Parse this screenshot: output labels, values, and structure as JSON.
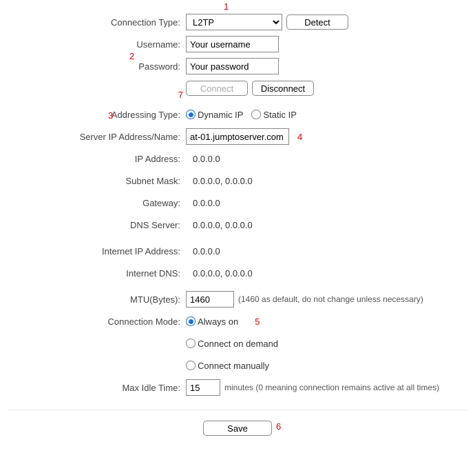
{
  "annotations": {
    "a1": "1",
    "a2": "2",
    "a3": "3",
    "a4": "4",
    "a5": "5",
    "a6": "6",
    "a7": "7"
  },
  "labels": {
    "connection_type": "Connection Type:",
    "username": "Username:",
    "password": "Password:",
    "addressing_type": "Addressing Type:",
    "server_ip": "Server IP Address/Name:",
    "ip_address": "IP Address:",
    "subnet_mask": "Subnet Mask:",
    "gateway": "Gateway:",
    "dns_server": "DNS Server:",
    "internet_ip": "Internet IP Address:",
    "internet_dns": "Internet DNS:",
    "mtu": "MTU(Bytes):",
    "connection_mode": "Connection Mode:",
    "max_idle": "Max Idle Time:"
  },
  "values": {
    "connection_type": "L2TP",
    "username": "Your username",
    "password": "Your password",
    "server_ip": "at-01.jumptoserver.com",
    "ip_address": "0.0.0.0",
    "subnet_mask": "0.0.0.0,   0.0.0.0",
    "gateway": "0.0.0.0",
    "dns_server": "0.0.0.0,   0.0.0.0",
    "internet_ip": "0.0.0.0",
    "internet_dns": "0.0.0.0,   0.0.0.0",
    "mtu": "1460",
    "max_idle": "15"
  },
  "radios": {
    "dynamic_ip": "Dynamic IP",
    "static_ip": "Static IP",
    "always_on": "Always on",
    "on_demand": "Connect on demand",
    "manually": "Connect manually"
  },
  "buttons": {
    "detect": "Detect",
    "connect": "Connect",
    "disconnect": "Disconnect",
    "save": "Save"
  },
  "hints": {
    "mtu": "(1460 as default, do not change unless necessary)",
    "max_idle": "minutes (0 meaning connection remains active at all times)"
  }
}
